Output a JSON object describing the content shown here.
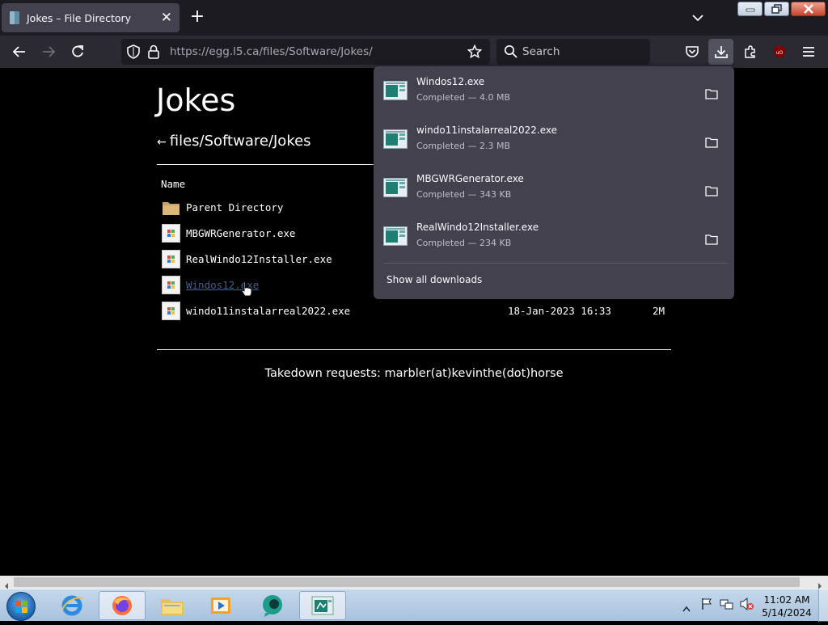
{
  "browser": {
    "tab_title": "Jokes – File Directory",
    "url": "https://egg.l5.ca/files/Software/Jokes/",
    "search_placeholder": "Search"
  },
  "page": {
    "heading": "Jokes",
    "breadcrumb_arrow": "←",
    "breadcrumb": "files/Software/Jokes",
    "column_name": "Name",
    "rows": [
      {
        "name": "Parent Directory",
        "date": "",
        "size": "",
        "type": "folder"
      },
      {
        "name": "MBGWRGenerator.exe",
        "date": "",
        "size": "",
        "type": "exe"
      },
      {
        "name": "RealWindo12Installer.exe",
        "date": "",
        "size": "",
        "type": "exe"
      },
      {
        "name": "Windos12.exe",
        "date": "",
        "size": "",
        "type": "exe",
        "hovered": true
      },
      {
        "name": "windo11instalarreal2022.exe",
        "date": "18-Jan-2023 16:33",
        "size": "2M",
        "type": "exe"
      }
    ],
    "footer": "Takedown requests: marbler(at)kevinthe(dot)horse"
  },
  "downloads_panel": {
    "items": [
      {
        "filename": "Windos12.exe",
        "status": "Completed — 4.0 MB"
      },
      {
        "filename": "windo11instalarreal2022.exe",
        "status": "Completed — 2.3 MB"
      },
      {
        "filename": "MBGWRGenerator.exe",
        "status": "Completed — 343 KB"
      },
      {
        "filename": "RealWindo12Installer.exe",
        "status": "Completed — 234 KB"
      }
    ],
    "show_all_label": "Show all downloads"
  },
  "taskbar": {
    "time": "11:02 AM",
    "date": "5/14/2024"
  },
  "colors": {
    "chrome_dark": "#1c1b22",
    "toolbar": "#2b2a33",
    "panel": "#42414d",
    "link_visited": "#3f5f8f"
  }
}
